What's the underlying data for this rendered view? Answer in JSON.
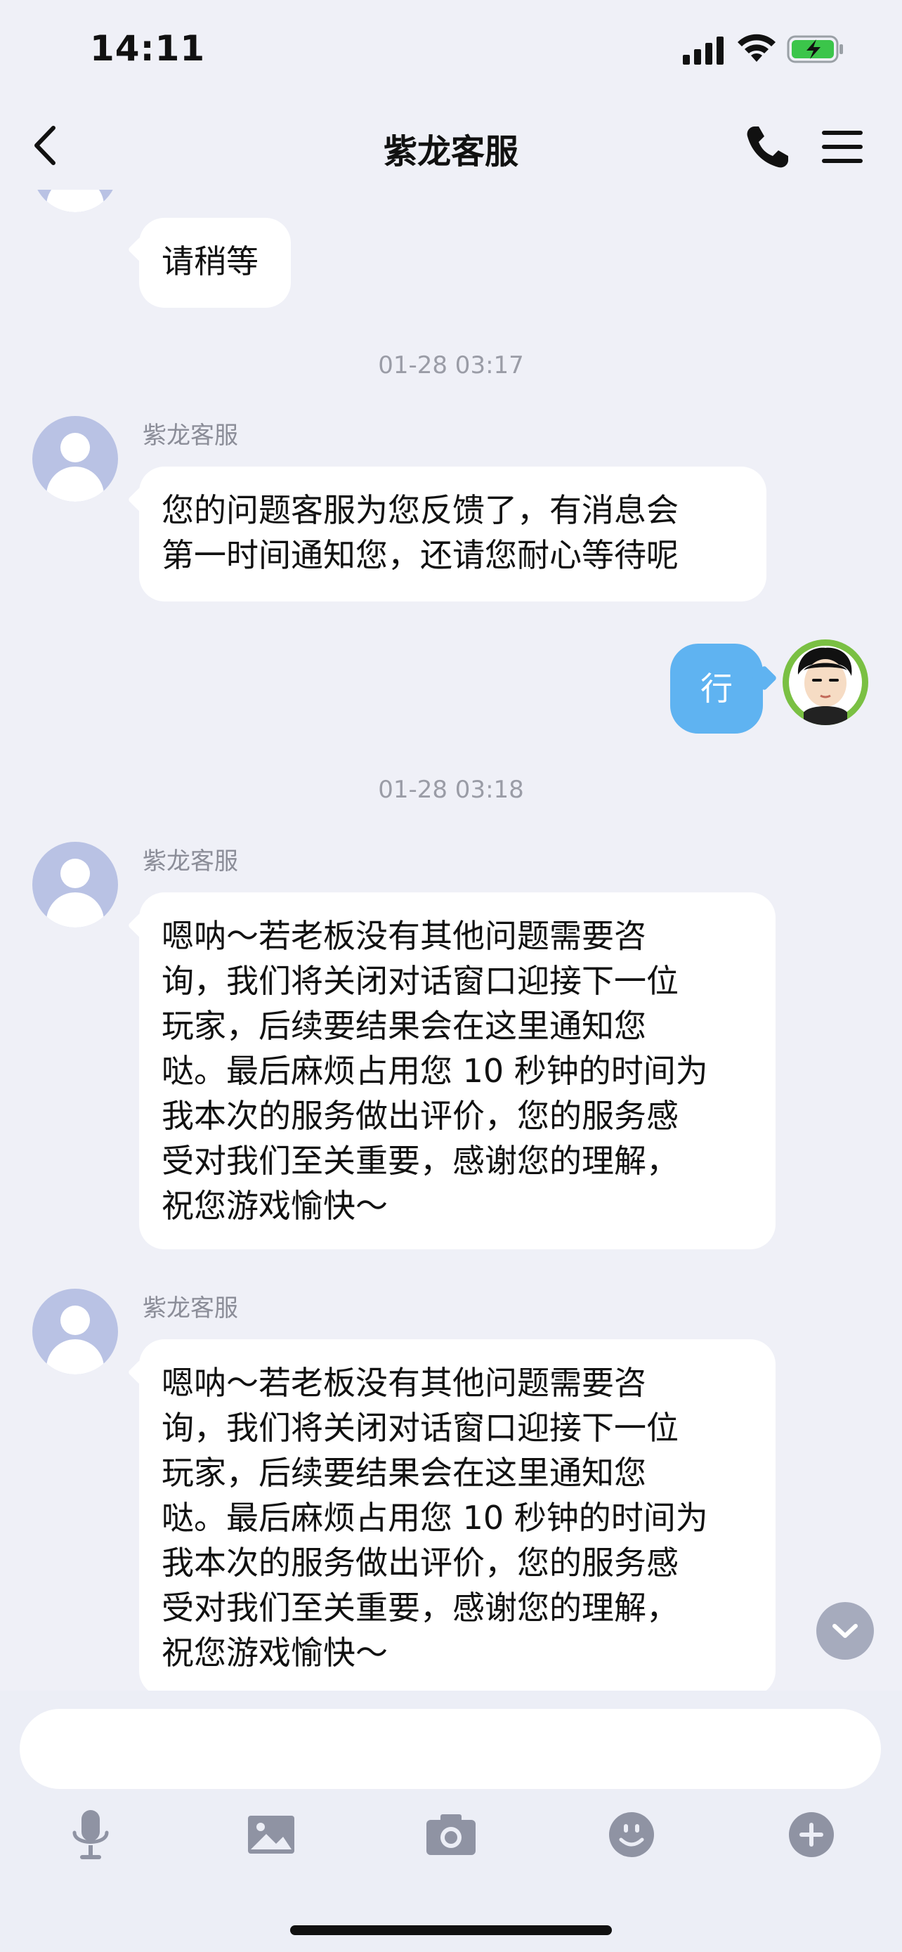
{
  "status_bar": {
    "time": "14:11"
  },
  "header": {
    "title": "紫龙客服"
  },
  "messages": [
    {
      "sender": "紫龙客服",
      "text": "请稍等"
    },
    {
      "timestamp": "01-28 03:17"
    },
    {
      "sender": "紫龙客服",
      "lines": [
        "您的问题客服为您反馈了，有消息会",
        "第一时间通知您，还请您耐心等待呢"
      ]
    },
    {
      "from_me": true,
      "text": "行"
    },
    {
      "timestamp": "01-28 03:18"
    },
    {
      "sender": "紫龙客服",
      "lines": [
        "嗯呐～若老板没有其他问题需要咨",
        "询，我们将关闭对话窗口迎接下一位",
        "玩家，后续要结果会在这里通知您",
        "哒。最后麻烦占用您 10 秒钟的时间为",
        "我本次的服务做出评价，您的服务感",
        "受对我们至关重要，感谢您的理解，",
        "祝您游戏愉快～"
      ]
    },
    {
      "sender": "紫龙客服",
      "lines": [
        "嗯呐～若老板没有其他问题需要咨",
        "询，我们将关闭对话窗口迎接下一位",
        "玩家，后续要结果会在这里通知您",
        "哒。最后麻烦占用您 10 秒钟的时间为",
        "我本次的服务做出评价，您的服务感",
        "受对我们至关重要，感谢您的理解，",
        "祝您游戏愉快～"
      ]
    }
  ],
  "input": {
    "value": ""
  },
  "toolbar": [
    "microphone-icon",
    "image-icon",
    "camera-icon",
    "emoji-icon",
    "plus-icon"
  ],
  "colors": {
    "background": "#eff0f7",
    "bubble_me": "#5fb3f1",
    "bubble_other": "#ffffff",
    "avatar_placeholder": "#b9c2e4"
  }
}
